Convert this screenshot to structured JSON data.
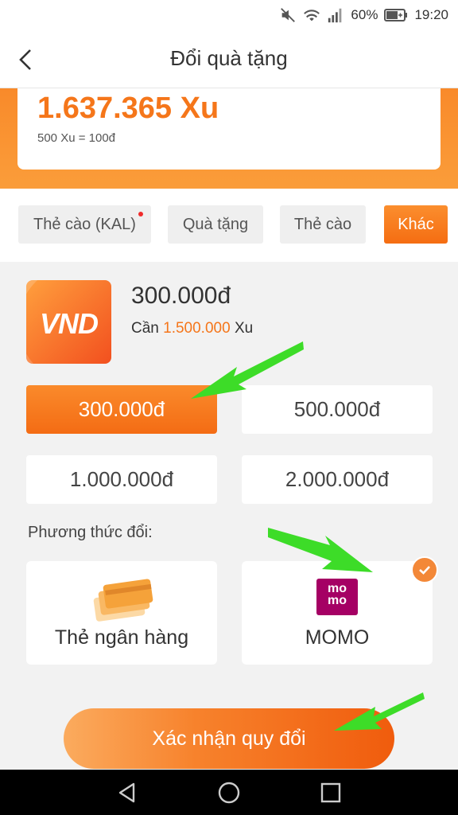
{
  "status_bar": {
    "battery": "60%",
    "time": "19:20",
    "icons": [
      "mute-icon",
      "wifi-icon",
      "signal-icon",
      "battery-icon"
    ]
  },
  "header": {
    "title": "Đổi quà tặng",
    "back_icon": "chevron-left-icon"
  },
  "balance": {
    "amount": "1.637.365 Xu",
    "rate": "500 Xu = 100đ"
  },
  "tabs": [
    {
      "label": "Thẻ cào (KAL)",
      "has_dot": true
    },
    {
      "label": "Quà tặng"
    },
    {
      "label": "Thẻ cào"
    },
    {
      "label": "Khác",
      "active": true
    }
  ],
  "product": {
    "logo_text": "VND",
    "price": "300.000đ",
    "need_prefix": "Cần",
    "need_amount": "1.500.000",
    "need_unit": "Xu"
  },
  "amount_options": [
    {
      "label": "300.000đ",
      "selected": true
    },
    {
      "label": "500.000đ"
    },
    {
      "label": "1.000.000đ"
    },
    {
      "label": "2.000.000đ"
    }
  ],
  "method_section": {
    "label": "Phương thức đổi:",
    "methods": [
      {
        "name": "Thẻ ngân hàng",
        "icon": "bank-card-icon"
      },
      {
        "name": "MOMO",
        "icon": "momo-icon",
        "logo_line1": "mo",
        "logo_line2": "mo",
        "selected": true
      }
    ]
  },
  "confirm_button": {
    "label": "Xác nhận quy đổi"
  },
  "colors": {
    "accent": "#f5761a",
    "arrow": "#3ddc28",
    "momo": "#a50064"
  },
  "nav_bar": {
    "icons": [
      "back-triangle-icon",
      "home-circle-icon",
      "recents-square-icon"
    ]
  }
}
